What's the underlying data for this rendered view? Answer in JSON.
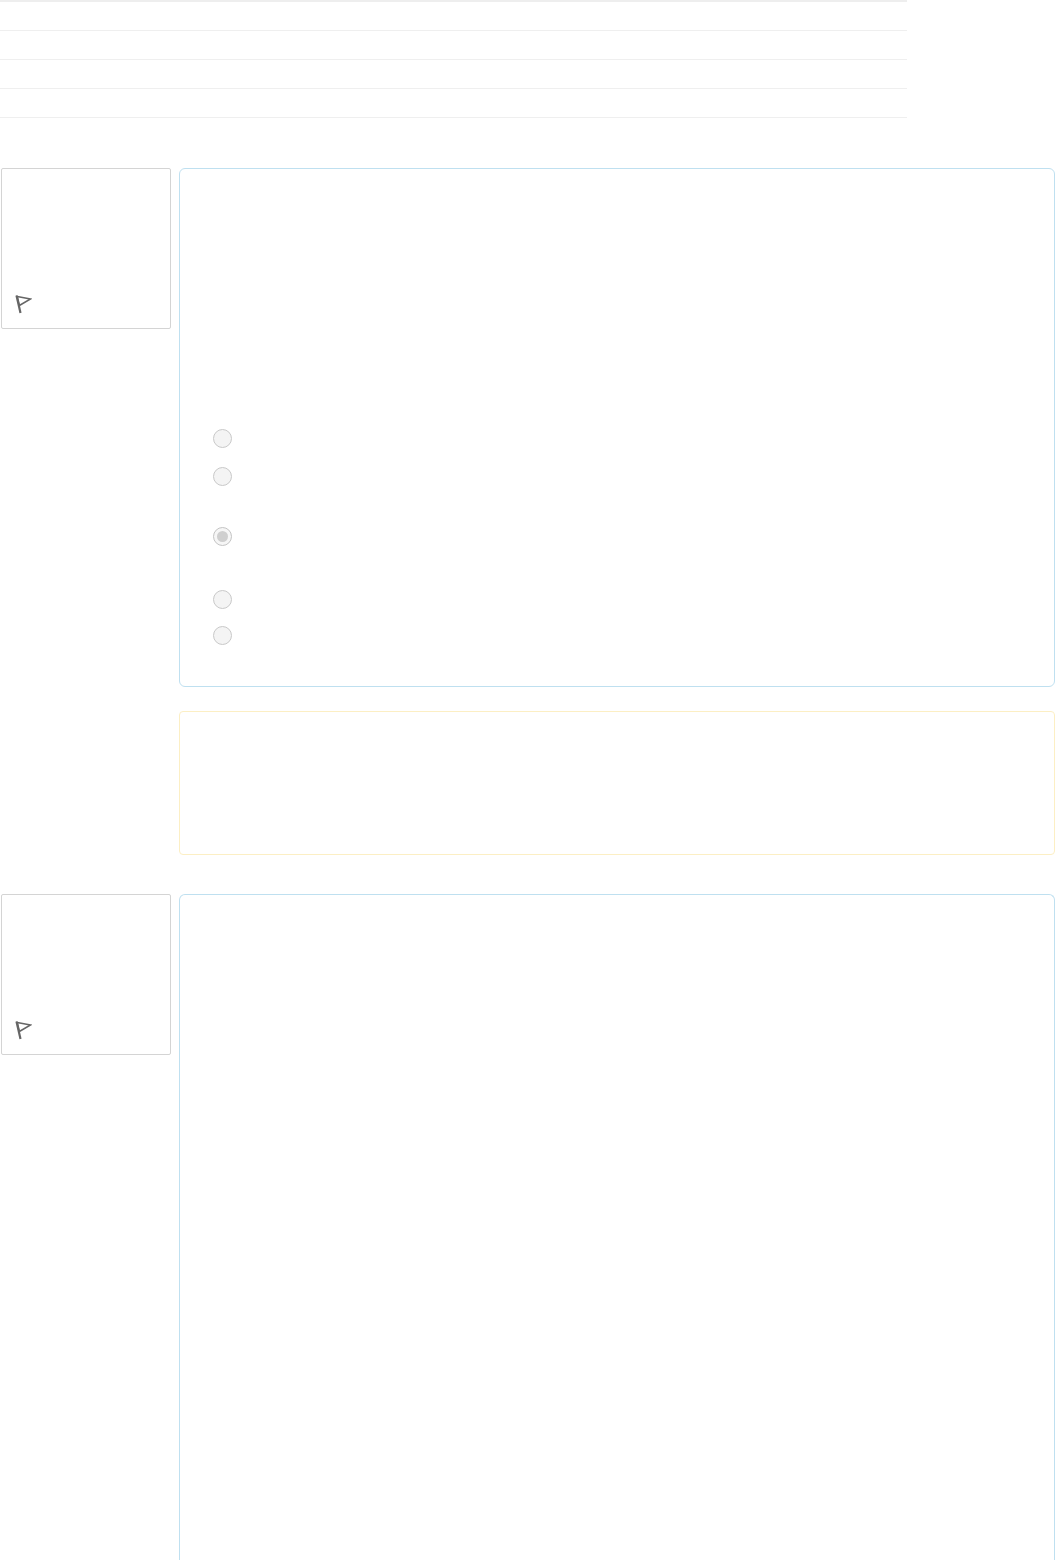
{
  "questions": [
    {
      "info": {
        "flagged": false
      },
      "answer_options": [
        {
          "selected": false
        },
        {
          "selected": false
        },
        {
          "selected": true
        },
        {
          "selected": false
        },
        {
          "selected": false
        }
      ],
      "feedback_shown": true
    },
    {
      "info": {
        "flagged": false
      }
    }
  ]
}
